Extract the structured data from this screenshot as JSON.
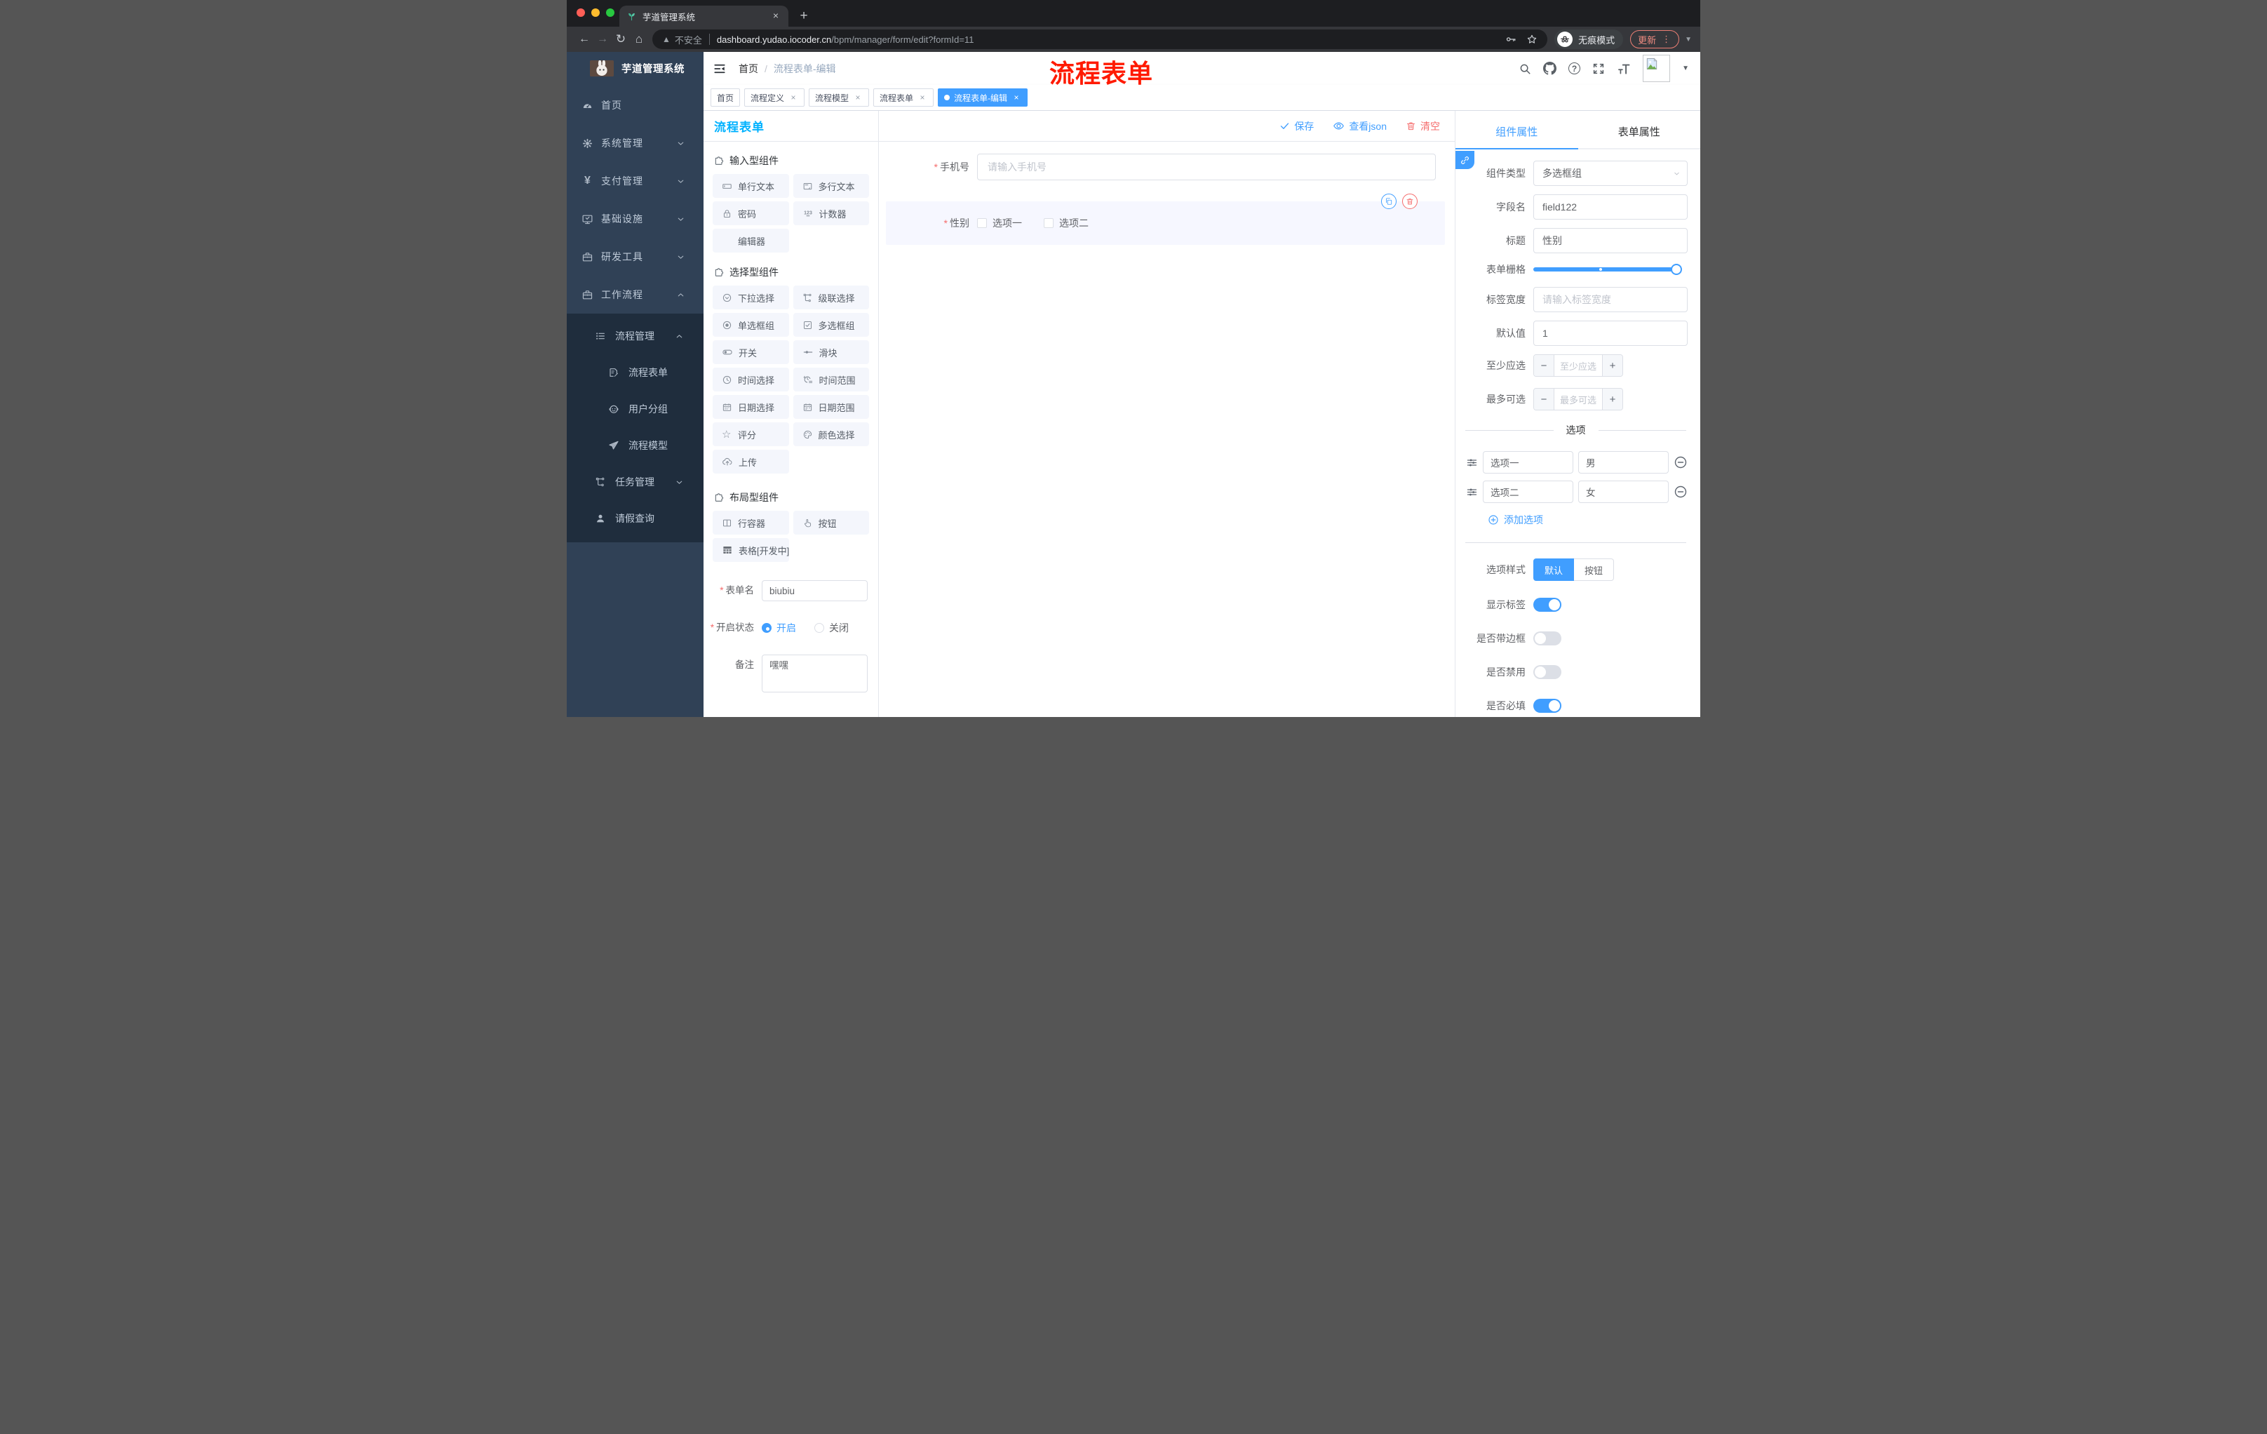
{
  "annotation": "流程表单",
  "browser": {
    "tab_title": "芋道管理系统",
    "security_label": "不安全",
    "url_host": "dashboard.yudao.iocoder.cn",
    "url_path": "/bpm/manager/form/edit?formId=11",
    "incognito_label": "无痕模式",
    "update_label": "更新"
  },
  "sidebar": {
    "app_title": "芋道管理系统",
    "items": [
      "首页",
      "系统管理",
      "支付管理",
      "基础设施",
      "研发工具",
      "工作流程"
    ],
    "sub": [
      "流程管理",
      "流程表单",
      "用户分组",
      "流程模型",
      "任务管理",
      "请假查询"
    ]
  },
  "header": {
    "bc_home": "首页",
    "bc_sep": "/",
    "bc_current": "流程表单-编辑"
  },
  "tags": [
    "首页",
    "流程定义",
    "流程模型",
    "流程表单",
    "流程表单-编辑"
  ],
  "designer": {
    "title": "流程表单",
    "actions": {
      "save": "保存",
      "view_json": "查看json",
      "clear": "清空"
    },
    "groups": [
      {
        "title": "输入型组件",
        "items": [
          "单行文本",
          "多行文本",
          "密码",
          "计数器",
          "编辑器"
        ]
      },
      {
        "title": "选择型组件",
        "items": [
          "下拉选择",
          "级联选择",
          "单选框组",
          "多选框组",
          "开关",
          "滑块",
          "时间选择",
          "时间范围",
          "日期选择",
          "日期范围",
          "评分",
          "颜色选择",
          "上传"
        ]
      },
      {
        "title": "布局型组件",
        "items": [
          "行容器",
          "按钮",
          "表格[开发中]"
        ]
      }
    ],
    "meta": {
      "name_label": "表单名",
      "name_value": "biubiu",
      "status_label": "开启状态",
      "status_on": "开启",
      "status_off": "关闭",
      "remark_label": "备注",
      "remark_value": "嘿嘿"
    },
    "canvas": {
      "phone_label": "手机号",
      "phone_placeholder": "请输入手机号",
      "gender_label": "性别",
      "opt1": "选项一",
      "opt2": "选项二"
    }
  },
  "panel": {
    "tab_component": "组件属性",
    "tab_form": "表单属性",
    "rows": {
      "type_label": "组件类型",
      "type_value": "多选框组",
      "field_label": "字段名",
      "field_value": "field122",
      "title_label": "标题",
      "title_value": "性别",
      "grid_label": "表单栅格",
      "width_label": "标签宽度",
      "width_placeholder": "请输入标签宽度",
      "default_label": "默认值",
      "default_value": "1",
      "min_label": "至少应选",
      "min_placeholder": "至少应选",
      "max_label": "最多可选",
      "max_placeholder": "最多可选"
    },
    "options": {
      "divider": "选项",
      "row1_label": "选项一",
      "row1_value": "男",
      "row2_label": "选项二",
      "row2_value": "女",
      "add": "添加选项",
      "style_label": "选项样式",
      "style_default": "默认",
      "style_button": "按钮",
      "t1": "显示标签",
      "t2": "是否带边框",
      "t3": "是否禁用",
      "t4": "是否必填"
    }
  },
  "colors": {
    "primary": "#409eff",
    "danger": "#f56c6c",
    "panel_title": "#00b2ff",
    "sidebar_bg": "#304156",
    "submenu_bg": "#1f2d3d",
    "chip_bg": "#f4f6fc",
    "selected_block_bg": "#f6f7ff",
    "annotation_red": "#ff1a00"
  }
}
